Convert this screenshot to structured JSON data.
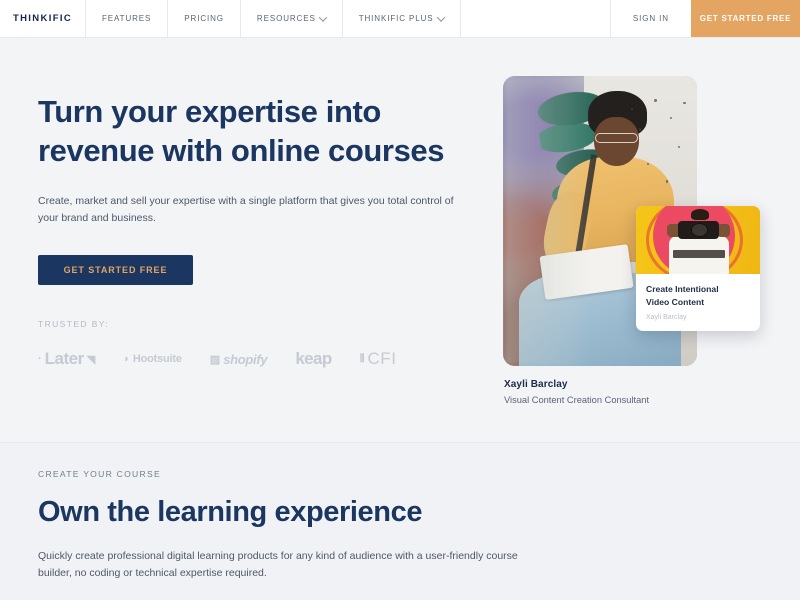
{
  "navbar": {
    "brand": "THINKIFIC",
    "items": [
      {
        "label": "FEATURES",
        "has_chevron": false,
        "icon": null
      },
      {
        "label": "PRICING",
        "has_chevron": false,
        "icon": null
      },
      {
        "label": "RESOURCES",
        "has_chevron": true,
        "icon": "chevron-down-icon"
      },
      {
        "label": "THINKIFIC PLUS",
        "has_chevron": true,
        "icon": "chevron-down-icon"
      }
    ],
    "sign_in": "SIGN IN",
    "cta": "GET STARTED FREE",
    "cta_color": "#e4a462"
  },
  "hero": {
    "title": "Turn your expertise into revenue with online courses",
    "subtitle": "Create, market and sell your expertise with a single platform that gives you total control of your brand and business.",
    "cta": "GET STARTED FREE",
    "cta_bg": "#1b3660",
    "cta_text_color": "#e4a462",
    "trusted_label": "TRUSTED BY:",
    "logos": [
      {
        "name": "Later"
      },
      {
        "name": "Hootsuite"
      },
      {
        "name": "shopify"
      },
      {
        "name": "keap"
      },
      {
        "name": "CFI"
      }
    ],
    "course_card": {
      "title_line1": "Create Intentional",
      "title_line2": "Video Content",
      "author": "Xayli Barclay"
    },
    "caption": {
      "name": "Xayli Barclay",
      "role": "Visual Content Creation Consultant"
    }
  },
  "section2": {
    "eyebrow": "CREATE YOUR COURSE",
    "title": "Own the learning experience",
    "body": "Quickly create professional digital learning products for any kind of audience with a user-friendly course builder, no coding or technical expertise required."
  },
  "theme": {
    "navy": "#1b3660",
    "orange": "#e4a462",
    "page_bg": "#f3f4f6",
    "muted": "#5b6378"
  }
}
